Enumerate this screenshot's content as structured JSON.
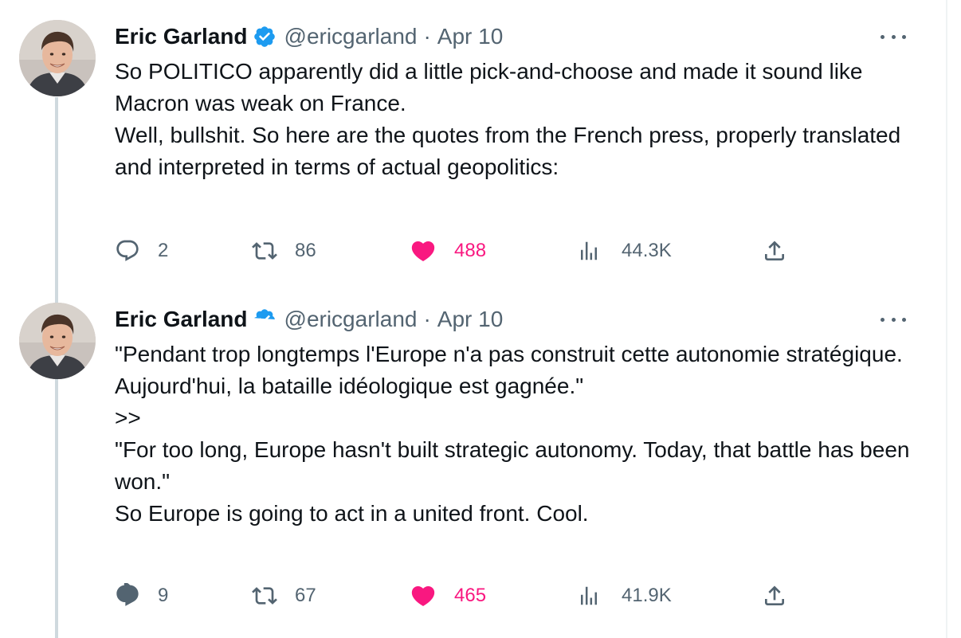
{
  "tweets": [
    {
      "author": {
        "name": "Eric Garland",
        "handle": "@ericgarland",
        "date": "Apr 10",
        "separator": "·"
      },
      "text": [
        "So POLITICO apparently did a little pick-and-choose and made it sound like Macron was weak on France.",
        "",
        "Well, bullshit. So here are the quotes from the French press, properly translated and interpreted in terms of actual geopolitics:"
      ],
      "stats": {
        "replies": "2",
        "retweets": "86",
        "likes": "488",
        "views": "44.3K"
      }
    },
    {
      "author": {
        "name": "Eric Garland",
        "handle": "@ericgarland",
        "date": "Apr 10",
        "separator": "·"
      },
      "text": [
        "\"Pendant trop longtemps l'Europe n'a pas construit cette autonomie stratégique. Aujourd'hui, la bataille idéologique est gagnée.\"",
        ">>",
        "\"For too long, Europe hasn't built strategic autonomy. Today, that battle has been won.\"",
        "",
        "So Europe is going to act in a united front. Cool."
      ],
      "stats": {
        "replies": "9",
        "retweets": "67",
        "likes": "465",
        "views": "41.9K"
      }
    }
  ],
  "icons": {
    "verified": "verified-badge-icon",
    "more": "more-dots-icon",
    "reply": "reply-bubble-icon",
    "retweet": "retweet-icon",
    "like": "heart-icon",
    "views": "views-bars-icon",
    "share": "share-upload-icon"
  },
  "colors": {
    "text": "#0f1419",
    "secondary": "#536471",
    "verified": "#1d9bf0",
    "like": "#f91880",
    "thread_line": "#cfd9de"
  }
}
